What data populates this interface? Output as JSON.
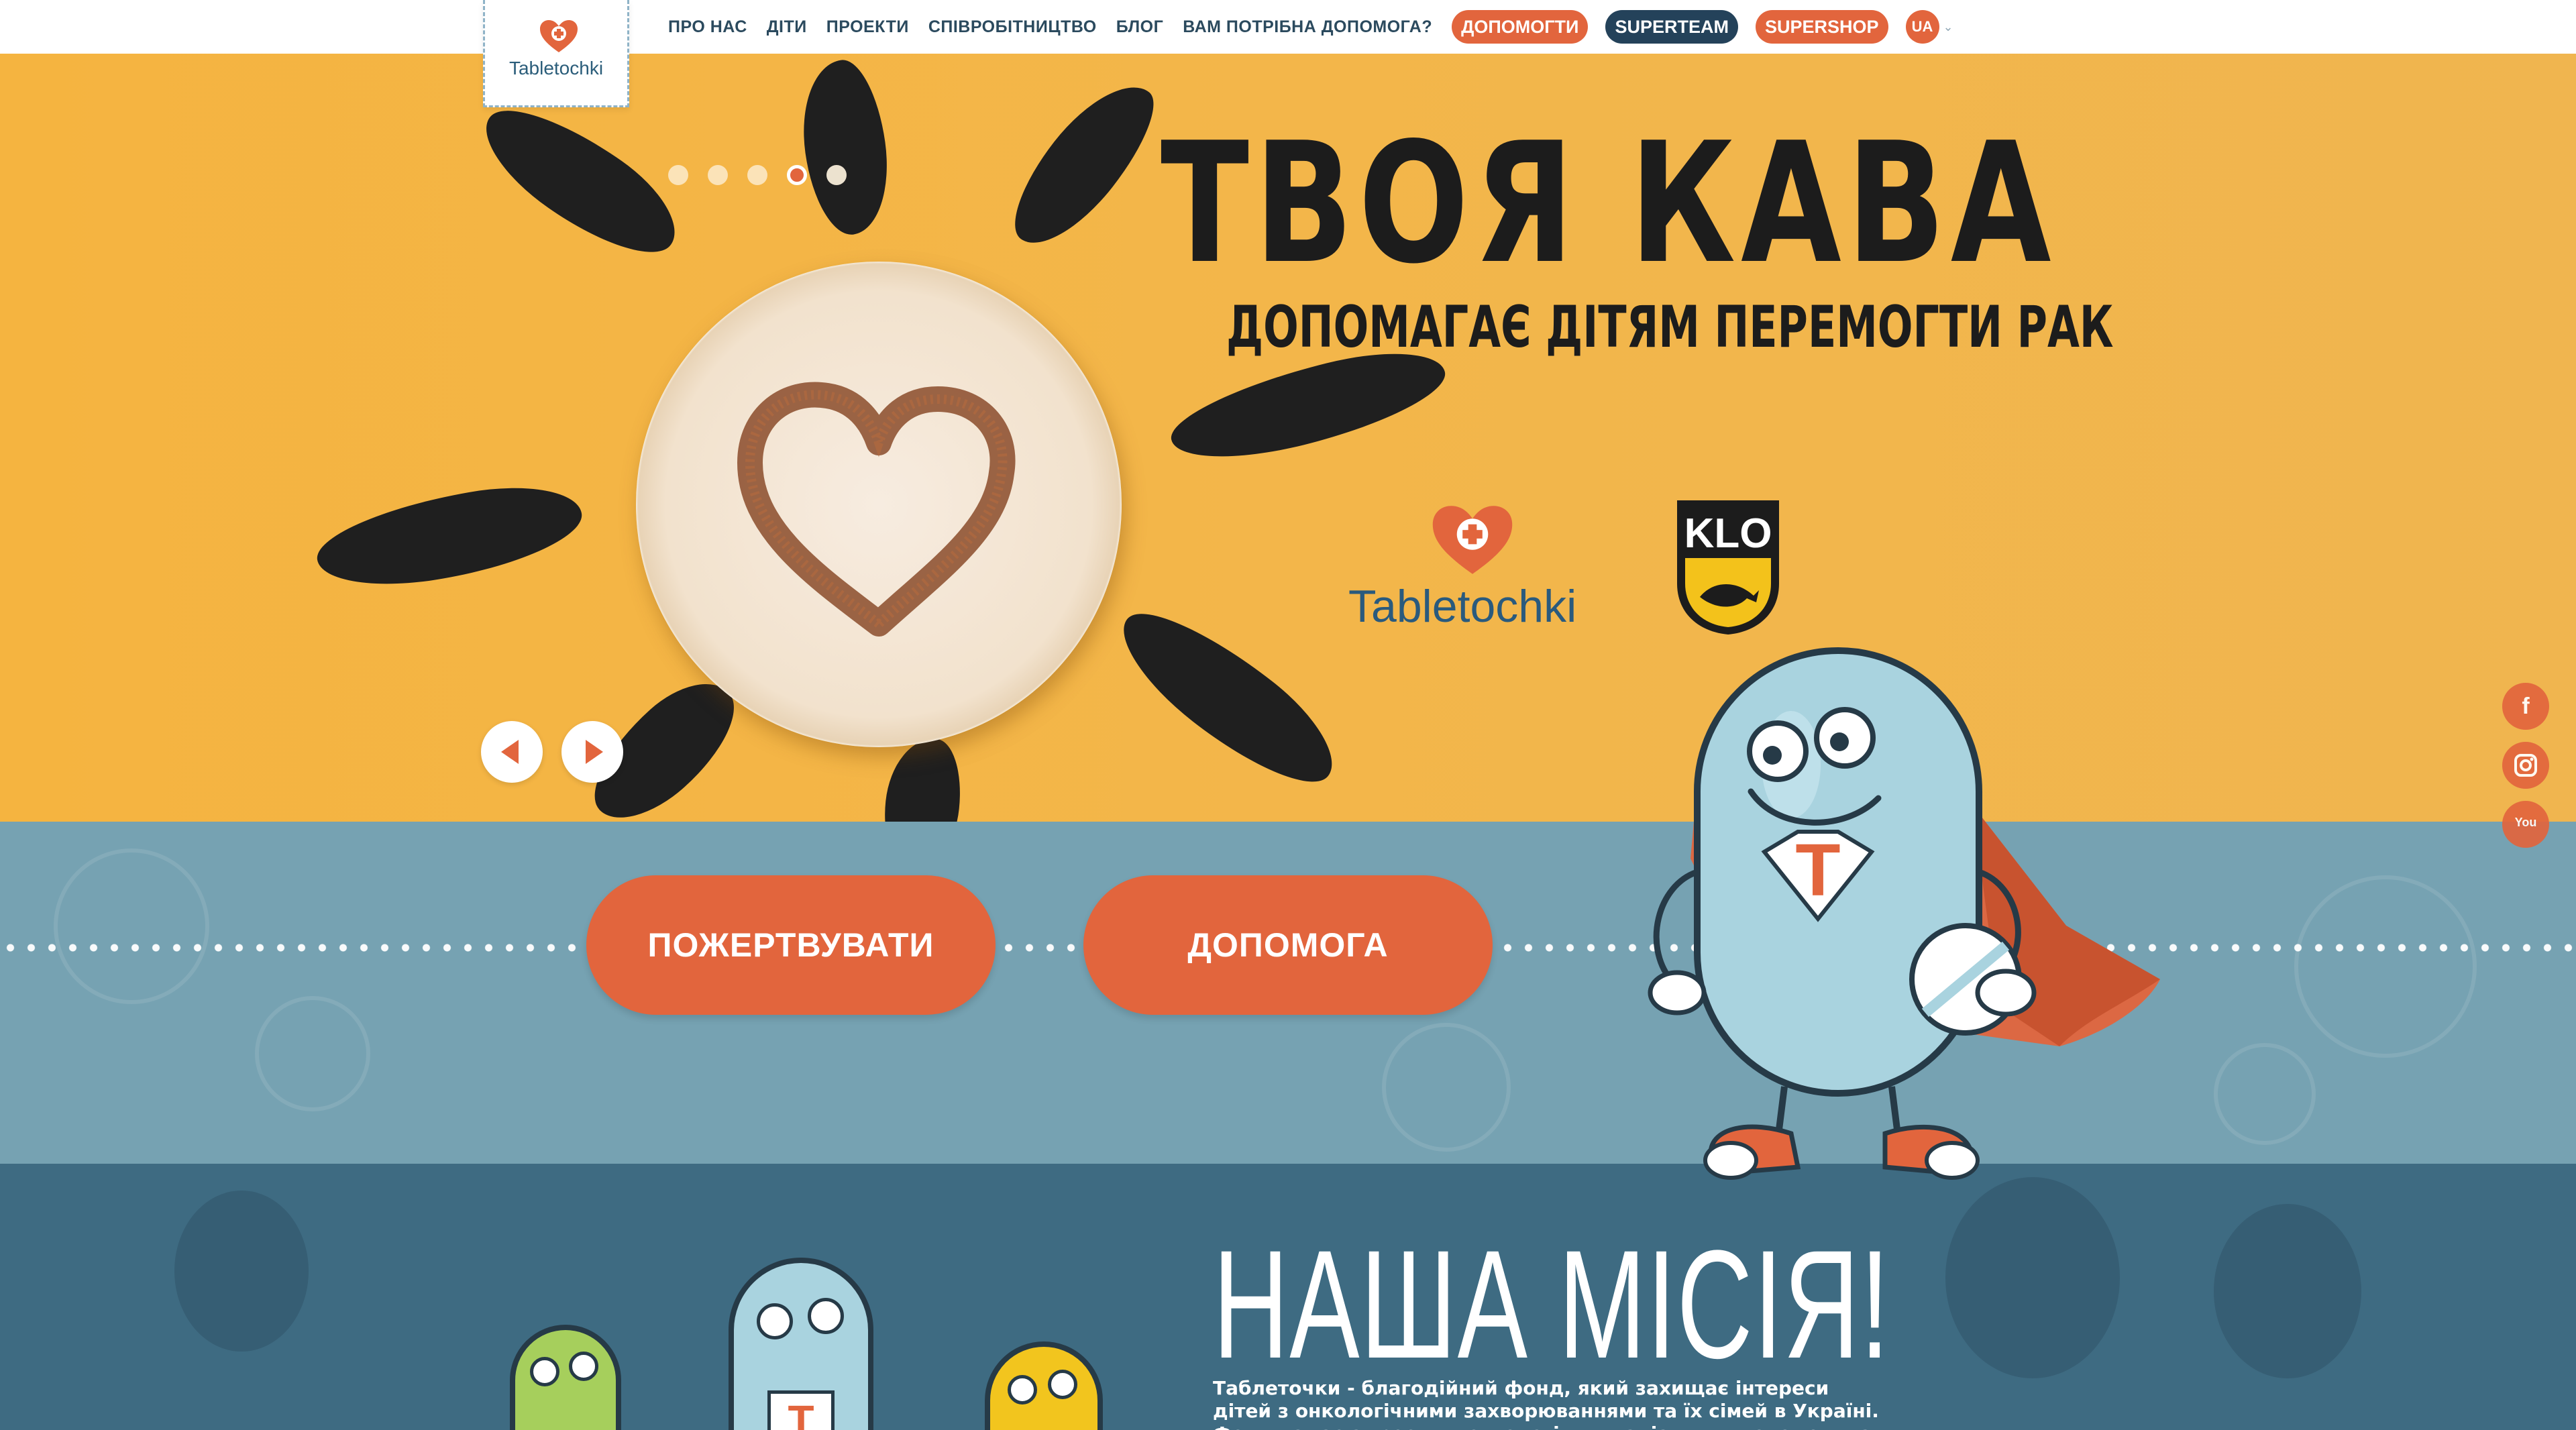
{
  "header": {
    "logo_text": "Tabletochki",
    "nav": [
      "ПРО НАС",
      "ДІТИ",
      "ПРОЕКТИ",
      "СПІВРОБІТНИЦТВО",
      "БЛОГ",
      "ВАМ ПОТРІБНА ДОПОМОГА?"
    ],
    "pill_help": "ДОПОМОГТИ",
    "pill_superteam": "SUPERTEAM",
    "pill_supershop": "SUPERSHOP",
    "lang": "UA"
  },
  "hero": {
    "title": "ТВОЯ КАВА",
    "subtitle": "ДОПОМАГАЄ ДІТЯМ ПЕРЕМОГТИ РАК",
    "partner_logo_text": "Tabletochki",
    "partner2_logo_text": "KLO",
    "slides_total": 5,
    "active_slide": 4
  },
  "social": {
    "facebook": "f",
    "instagram": "instagram-icon",
    "youtube": "You"
  },
  "actions": {
    "donate_label": "ПОЖЕРТВУВАТИ",
    "help_label": "ДОПОМОГА"
  },
  "mission": {
    "title": "НАША МІСІЯ!",
    "text": "Таблеточки - благодійний фонд, який захищає інтереси дітей з онкологічними захворюваннями та їх сімей в Україні. Фонд надає адресну, психологічну, паліативну допомогу та системно"
  },
  "colors": {
    "accent": "#e2653d",
    "dark": "#24425a",
    "hero_bg": "#f5b440",
    "band_bg": "#76a2b2",
    "mission_bg": "#3e6b82"
  }
}
